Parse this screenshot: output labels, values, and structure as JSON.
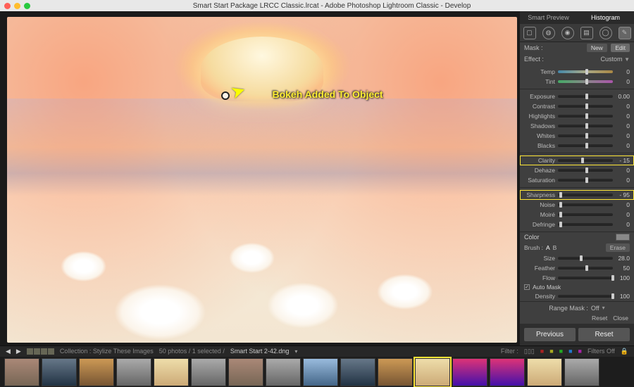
{
  "window": {
    "title": "Smart Start Package LRCC Classic.lrcat - Adobe Photoshop Lightroom Classic - Develop"
  },
  "annotation": {
    "text": "Bokeh Added To Object"
  },
  "panel": {
    "tabs": {
      "left": "Smart Preview",
      "right": "Histogram"
    },
    "mask": {
      "label": "Mask :",
      "new": "New",
      "edit": "Edit"
    },
    "effect": {
      "label": "Effect :",
      "preset": "Custom",
      "triangle": "▼"
    },
    "sliders1": [
      {
        "label": "Temp",
        "value": "0",
        "pos": 50,
        "cls": "color-temp"
      },
      {
        "label": "Tint",
        "value": "0",
        "pos": 50,
        "cls": "color-tint"
      }
    ],
    "sliders2": [
      {
        "label": "Exposure",
        "value": "0.00",
        "pos": 50
      },
      {
        "label": "Contrast",
        "value": "0",
        "pos": 50
      },
      {
        "label": "Highlights",
        "value": "0",
        "pos": 50
      },
      {
        "label": "Shadows",
        "value": "0",
        "pos": 50
      },
      {
        "label": "Whites",
        "value": "0",
        "pos": 50
      },
      {
        "label": "Blacks",
        "value": "0",
        "pos": 50
      }
    ],
    "sliders3": [
      {
        "label": "Clarity",
        "value": "- 15",
        "pos": 42,
        "hl": true
      },
      {
        "label": "Dehaze",
        "value": "0",
        "pos": 50
      },
      {
        "label": "Saturation",
        "value": "0",
        "pos": 50
      }
    ],
    "sliders4": [
      {
        "label": "Sharpness",
        "value": "- 95",
        "pos": 3,
        "hl": true
      },
      {
        "label": "Noise",
        "value": "0",
        "pos": 2
      },
      {
        "label": "Moiré",
        "value": "0",
        "pos": 2
      },
      {
        "label": "Defringe",
        "value": "0",
        "pos": 2
      }
    ],
    "color": {
      "label": "Color"
    },
    "brush": {
      "label": "Brush :",
      "a": "A",
      "b": "B",
      "erase": "Erase"
    },
    "brush_sliders": [
      {
        "label": "Size",
        "value": "28.0",
        "pos": 40
      },
      {
        "label": "Feather",
        "value": "50",
        "pos": 50
      },
      {
        "label": "Flow",
        "value": "100",
        "pos": 98
      }
    ],
    "automask": {
      "checked": true,
      "label": "Auto Mask"
    },
    "density": {
      "label": "Density",
      "value": "100",
      "pos": 98
    },
    "rangemask": {
      "label": "Range Mask :",
      "value": "Off"
    },
    "reset": "Reset",
    "close": "Close",
    "previous": "Previous",
    "reset_big": "Reset"
  },
  "collection": {
    "label": "Collection : Stylize These Images",
    "count": "50 photos / 1 selected /",
    "file": "Smart Start 2-42.dng",
    "filter": "Filter :",
    "filters_off": "Filters Off"
  },
  "filmstrip": {
    "selected_index": 11,
    "count": 16
  }
}
